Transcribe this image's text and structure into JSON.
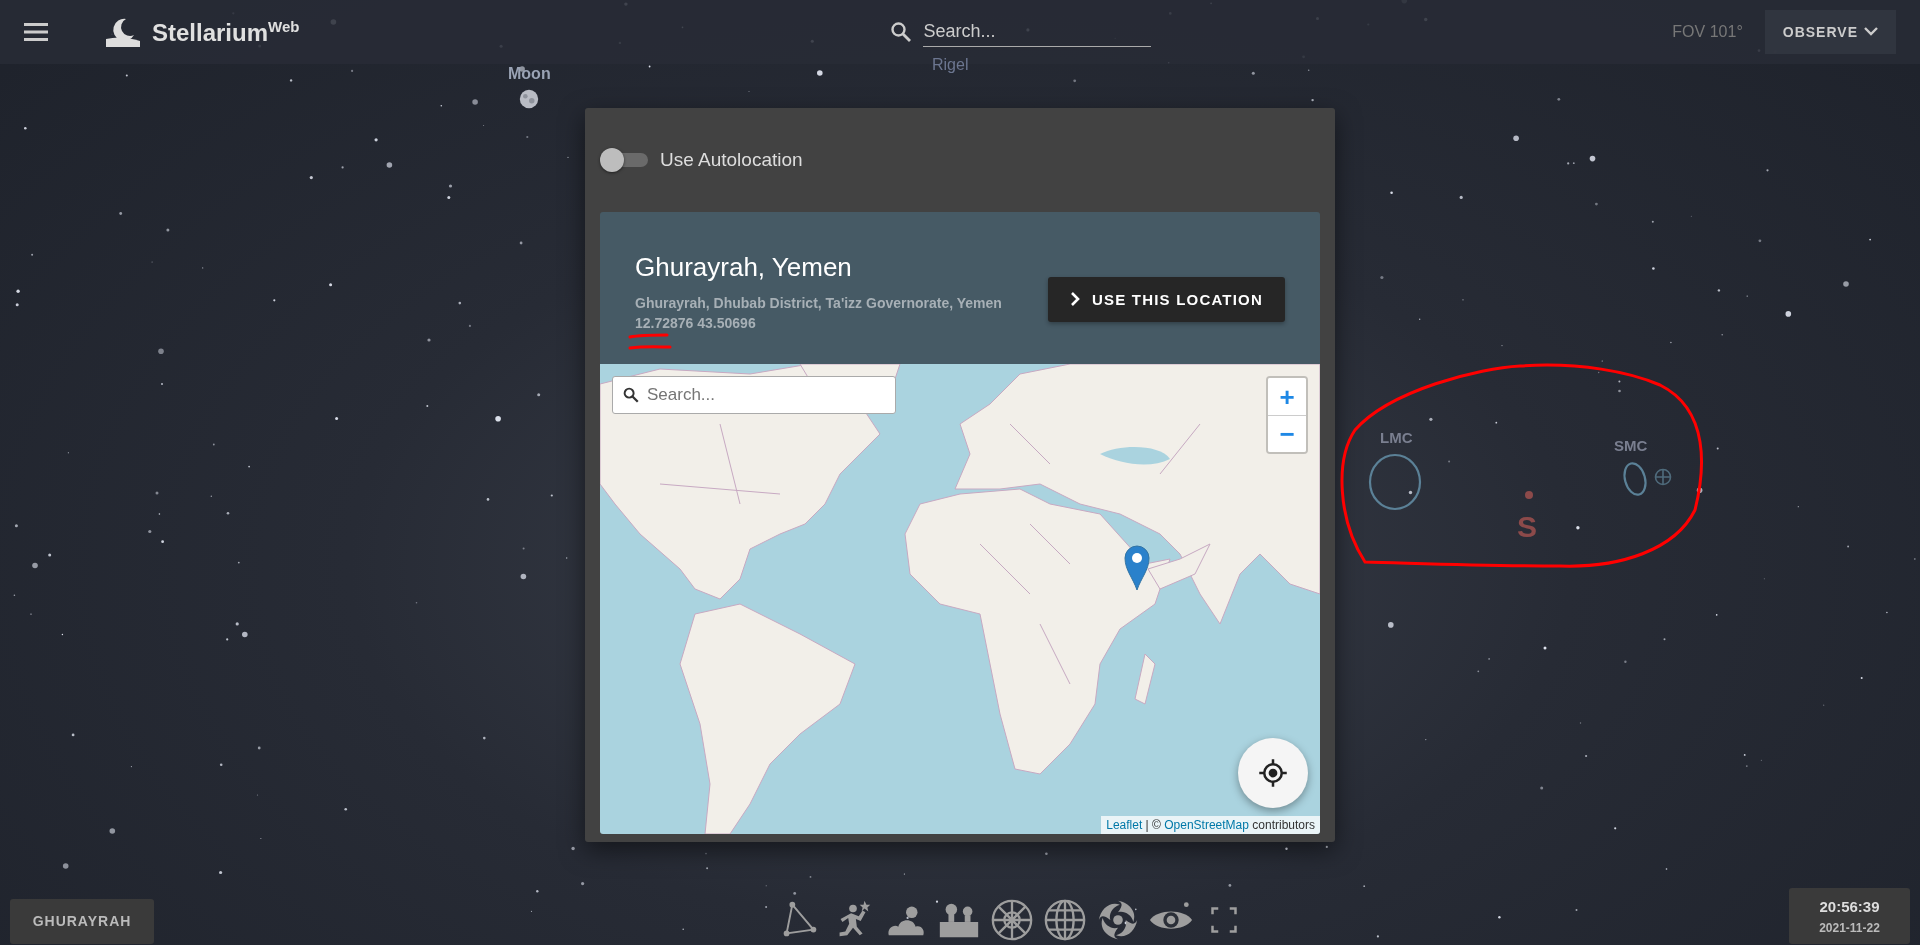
{
  "top_bar": {
    "app_name": "Stellarium",
    "app_name_sup": "Web",
    "search": {
      "placeholder": "Search..."
    },
    "fov": "FOV 101°",
    "observe_button": "OBSERVE"
  },
  "sky_labels": [
    {
      "kind": "planet",
      "text": "Moon"
    },
    {
      "kind": "star",
      "text": "Rigel"
    },
    {
      "kind": "galaxy",
      "text": "LMC"
    },
    {
      "kind": "galaxy",
      "text": "SMC"
    },
    {
      "kind": "cardinal",
      "text": "S"
    }
  ],
  "location_dialog": {
    "autolocation": {
      "label": "Use Autolocation",
      "on": false
    },
    "location": {
      "name": "Ghurayrah, Yemen",
      "address": "Ghurayrah, Dhubab District, Ta'izz Governorate, Yemen",
      "coordinates": "12.72876 43.50696"
    },
    "use_button": "USE THIS LOCATION",
    "map": {
      "search": {
        "placeholder": "Search..."
      },
      "zoom_in": "+",
      "zoom_out": "−",
      "attribution": [
        {
          "kind": "link",
          "text": "Leaflet"
        },
        {
          "kind": "text",
          "text": " | © "
        },
        {
          "kind": "link",
          "text": "OpenStreetMap"
        },
        {
          "kind": "text",
          "text": " contributors"
        }
      ]
    }
  },
  "bottom_bar": {
    "location_button": "GHURAYRAH",
    "toolbar": [
      {
        "kind": "constellation-lines"
      },
      {
        "kind": "constellation-art"
      },
      {
        "kind": "atmosphere"
      },
      {
        "kind": "landscape"
      },
      {
        "kind": "azimuthal-grid"
      },
      {
        "kind": "equatorial-grid"
      },
      {
        "kind": "nebulae"
      },
      {
        "kind": "deep-sky"
      },
      {
        "kind": "fullscreen"
      }
    ],
    "time": "20:56:39",
    "date": "2021-11-22"
  }
}
